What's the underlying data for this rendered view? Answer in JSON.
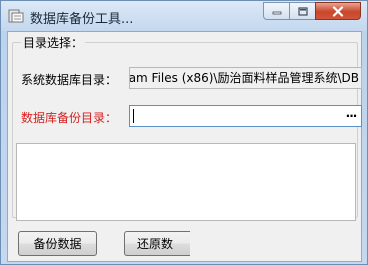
{
  "window": {
    "title": "数据库备份工具..."
  },
  "group": {
    "legend": "目录选择："
  },
  "system_dir": {
    "label": "系统数据库目录：",
    "value": "am Files (x86)\\励治面料样品管理系统\\DB"
  },
  "backup_dir": {
    "label": "数据库备份目录：",
    "value": "",
    "browse_label": "···"
  },
  "buttons": {
    "backup": "备份数据",
    "restore": "还原数"
  },
  "colors": {
    "required_label": "#d42020",
    "close_button": "#c9462b"
  },
  "icons": {
    "app": "app-icon",
    "minimize": "minimize-icon",
    "maximize": "maximize-icon",
    "close": "close-icon"
  }
}
